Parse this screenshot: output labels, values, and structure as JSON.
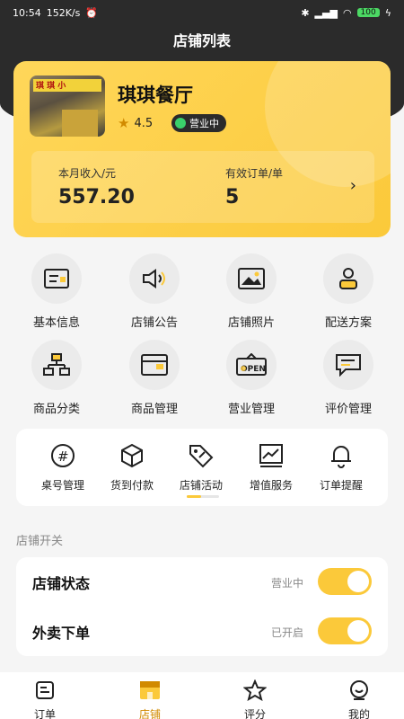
{
  "status_bar": {
    "time": "10:54",
    "speed": "152K/s",
    "battery": "100"
  },
  "header": {
    "title": "店铺列表"
  },
  "store": {
    "name": "琪琪餐厅",
    "rating": "4.5",
    "status": "营业中",
    "photo_sign": "琪 琪 小"
  },
  "stats": {
    "income_label": "本月收入/元",
    "income_value": "557.20",
    "orders_label": "有效订单/单",
    "orders_value": "5"
  },
  "grid": [
    {
      "label": "基本信息",
      "icon": "card-icon"
    },
    {
      "label": "店铺公告",
      "icon": "speaker-icon"
    },
    {
      "label": "店铺照片",
      "icon": "image-icon"
    },
    {
      "label": "配送方案",
      "icon": "courier-icon"
    },
    {
      "label": "商品分类",
      "icon": "category-icon"
    },
    {
      "label": "商品管理",
      "icon": "goods-icon"
    },
    {
      "label": "营业管理",
      "icon": "open-sign-icon"
    },
    {
      "label": "评价管理",
      "icon": "comment-icon"
    }
  ],
  "scroll_menu": [
    {
      "label": "桌号管理",
      "icon": "hash-icon"
    },
    {
      "label": "货到付款",
      "icon": "box-icon"
    },
    {
      "label": "店铺活动",
      "icon": "tag-icon"
    },
    {
      "label": "增值服务",
      "icon": "chart-icon"
    },
    {
      "label": "订单提醒",
      "icon": "bell-icon"
    }
  ],
  "switch_section": {
    "title": "店铺开关",
    "rows": [
      {
        "name": "店铺状态",
        "state": "营业中",
        "on": true
      },
      {
        "name": "外卖下单",
        "state": "已开启",
        "on": true
      }
    ]
  },
  "tabbar": [
    {
      "label": "订单",
      "icon": "order-icon"
    },
    {
      "label": "店铺",
      "icon": "shop-icon",
      "active": true
    },
    {
      "label": "评分",
      "icon": "star-icon"
    },
    {
      "label": "我的",
      "icon": "profile-icon"
    }
  ],
  "colors": {
    "accent": "#fbc93a",
    "dark": "#2b2b2b",
    "active_tab": "#d18a00"
  }
}
